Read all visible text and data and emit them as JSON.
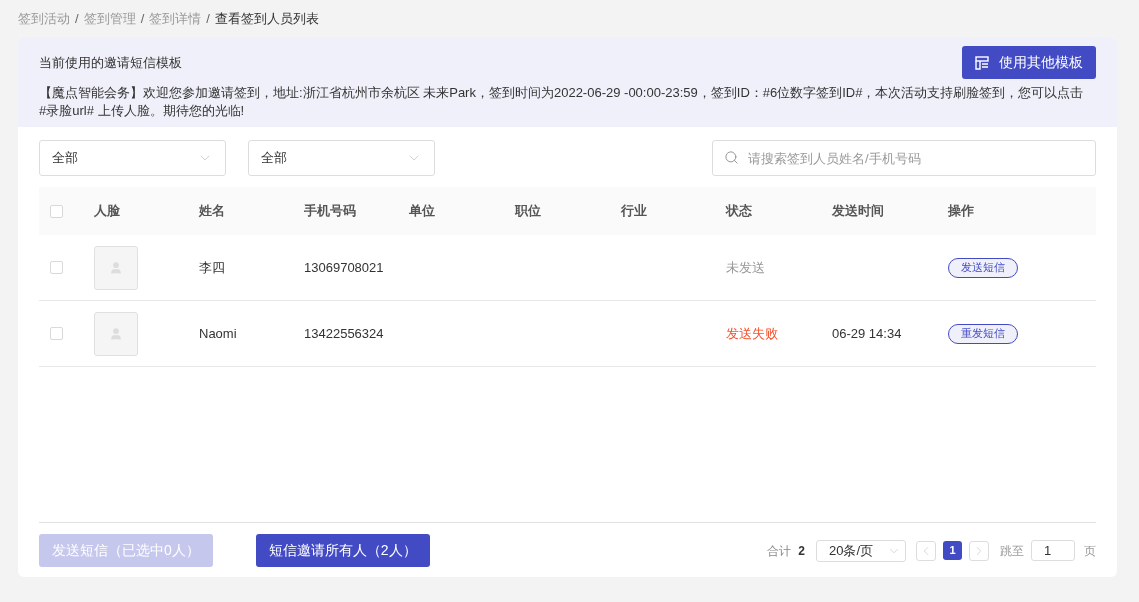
{
  "breadcrumb": [
    {
      "label": "签到活动",
      "current": false
    },
    {
      "label": "签到管理",
      "current": false
    },
    {
      "label": "签到详情",
      "current": false
    },
    {
      "label": "查看签到人员列表",
      "current": true
    }
  ],
  "breadcrumb_separator": "/",
  "template": {
    "title": "当前使用的邀请短信模板",
    "button": "使用其他模板",
    "text": "【魔点智能会务】欢迎您参加邀请签到，地址:浙江省杭州市余杭区 未来Park，签到时间为2022-06-29 -00:00-23:59，签到ID：#6位数字签到ID#，本次活动支持刷脸签到，您可以点击#录脸url# 上传人脸。期待您的光临!"
  },
  "filters": [
    {
      "value": "全部"
    },
    {
      "value": "全部"
    }
  ],
  "search": {
    "placeholder": "请搜索签到人员姓名/手机号码"
  },
  "table": {
    "header_checked": false,
    "columns": [
      "人脸",
      "姓名",
      "手机号码",
      "单位",
      "职位",
      "行业",
      "状态",
      "发送时间",
      "操作"
    ],
    "rows": [
      {
        "checked": false,
        "name": "李四",
        "phone": "13069708021",
        "status": "未发送",
        "color": "#999999",
        "action": "发送短信"
      },
      {
        "checked": false,
        "name": "Naomi",
        "phone": "13422556324",
        "status": "发送失败",
        "color": "#f5522d",
        "send_time": "06-29 14:34",
        "action": "重发短信"
      }
    ]
  },
  "footer": {
    "send_selected": {
      "label": "发送短信（已选中0人）",
      "disabled": true
    },
    "send_all": {
      "label": "短信邀请所有人（2人）",
      "disabled": false
    }
  },
  "pagination": {
    "total_label": "合计",
    "total": "2",
    "page_size": "20条/页",
    "pages": [
      {
        "label": "1",
        "selected": true
      }
    ],
    "jump_label": "跳至",
    "jump_value": "1",
    "page_suffix": "页"
  }
}
